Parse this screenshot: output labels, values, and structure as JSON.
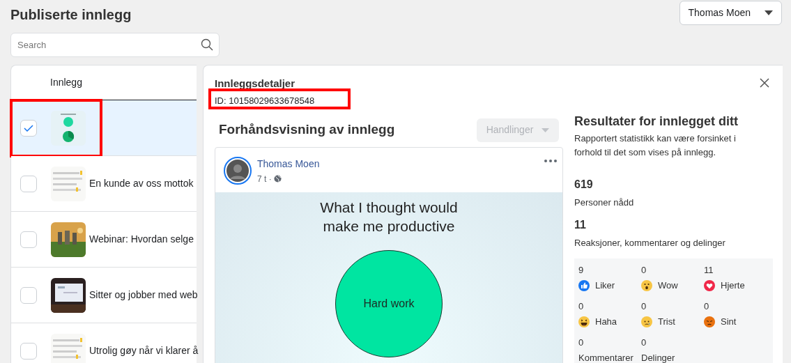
{
  "page_title": "Publiserte innlegg",
  "account_menu": {
    "label": "Thomas Moen"
  },
  "search": {
    "placeholder": "Search"
  },
  "posts_table": {
    "column_header": "Innlegg",
    "rows": [
      {
        "selected": true,
        "highlighted": true
      },
      {
        "text": "En kunde av oss mottok",
        "selected": false,
        "highlighted": false
      },
      {
        "text": "Webinar: Hvordan selge",
        "selected": false,
        "highlighted": false
      },
      {
        "text": "Sitter og jobber med web",
        "selected": false,
        "highlighted": false
      },
      {
        "text": "Utrolig gøy når vi klarer å",
        "selected": false,
        "highlighted": false
      }
    ]
  },
  "details": {
    "title": "Innleggsdetaljer",
    "id": {
      "text": "ID: 10158029633678548",
      "highlighted": true
    },
    "preview": {
      "heading": "Forhåndsvisning av innlegg",
      "actions_button": {
        "label": "Handlinger",
        "disabled": true
      },
      "post": {
        "author": "Thomas Moen",
        "meta": "7 t ·",
        "image": {
          "title": "What I thought would make me productive",
          "circle_label": "Hard work"
        }
      }
    },
    "results": {
      "heading": "Resultater for innlegget ditt",
      "note": "Rapportert statistikk kan være forsinket i forhold til det som vises på innlegg.",
      "metrics": [
        {
          "value": "619",
          "label": "Personer nådd"
        },
        {
          "value": "11",
          "label": "Reaksjoner, kommentarer og delinger"
        }
      ],
      "breakdown": [
        {
          "kind": "like",
          "count": "9",
          "label": "Liker"
        },
        {
          "kind": "wow",
          "count": "0",
          "label": "Wow"
        },
        {
          "kind": "love",
          "count": "11",
          "label": "Hjerte"
        },
        {
          "kind": "haha",
          "count": "0",
          "label": "Haha"
        },
        {
          "kind": "sad",
          "count": "0",
          "label": "Trist"
        },
        {
          "kind": "angry",
          "count": "0",
          "label": "Sint"
        },
        {
          "kind": "plain",
          "count": "0",
          "label": "Kommentarer"
        },
        {
          "kind": "plain",
          "count": "0",
          "label": "Delinger"
        }
      ]
    }
  }
}
